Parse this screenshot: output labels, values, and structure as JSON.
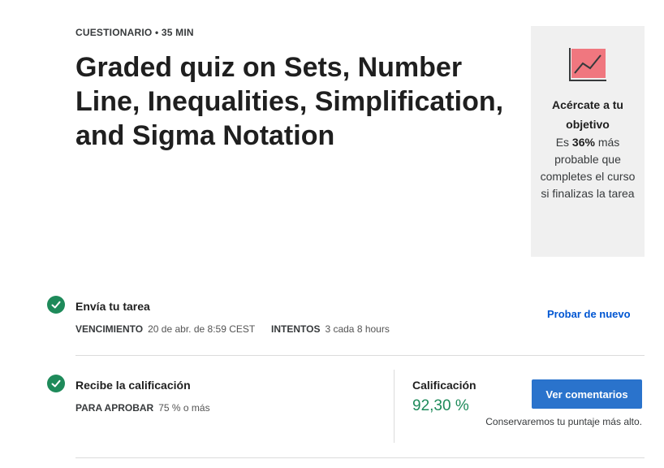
{
  "header": {
    "kicker": "CUESTIONARIO • 35 MIN",
    "title": "Graded quiz on Sets, Number Line, Inequalities, Simplification, and Sigma Notation"
  },
  "goal_card": {
    "icon": "chart-trend-icon",
    "heading": "Acércate a tu objetivo",
    "text_prefix": "Es ",
    "text_bold": "36%",
    "text_suffix": " más probable que completes el curso si finalizas la tarea"
  },
  "submit": {
    "title": "Envía tu tarea",
    "due_label": "VENCIMIENTO",
    "due_value": "20 de abr. de 8:59 CEST",
    "attempts_label": "INTENTOS",
    "attempts_value": "3 cada 8 hours",
    "retry_link": "Probar de nuevo",
    "status_icon": "check-circle-icon"
  },
  "grade": {
    "title": "Recibe la calificación",
    "pass_label": "PARA APROBAR",
    "pass_value": "75 % o más",
    "grade_label": "Calificación",
    "grade_value": "92,30 %",
    "feedback_button": "Ver comentarios",
    "note": "Conservaremos tu puntaje más alto.",
    "status_icon": "check-circle-icon"
  },
  "colors": {
    "success": "#1e8a5a",
    "primary_button": "#2a73cc",
    "link": "#0056d2",
    "goal_card_bg": "#f0f0f0",
    "icon_fill": "#f0777f"
  }
}
